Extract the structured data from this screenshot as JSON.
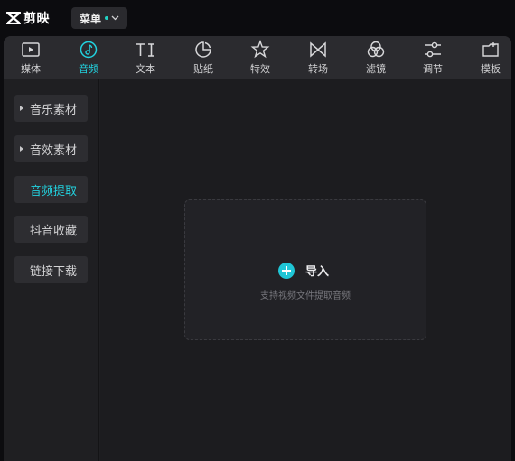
{
  "app": {
    "name": "剪映",
    "menu_label": "菜单"
  },
  "toolbar": {
    "active": "音频",
    "items": [
      {
        "label": "媒体",
        "icon": "media-play-icon"
      },
      {
        "label": "音频",
        "icon": "music-note-icon"
      },
      {
        "label": "文本",
        "icon": "text-ti-icon"
      },
      {
        "label": "贴纸",
        "icon": "sticker-icon"
      },
      {
        "label": "特效",
        "icon": "effects-star-icon"
      },
      {
        "label": "转场",
        "icon": "transition-bowtie-icon"
      },
      {
        "label": "滤镜",
        "icon": "filter-circles-icon"
      },
      {
        "label": "调节",
        "icon": "adjust-sliders-icon"
      },
      {
        "label": "模板",
        "icon": "template-icon"
      }
    ]
  },
  "sidebar": {
    "items": [
      {
        "label": "音乐素材",
        "expandable": true
      },
      {
        "label": "音效素材",
        "expandable": true
      },
      {
        "label": "音频提取",
        "active": true
      },
      {
        "label": "抖音收藏"
      },
      {
        "label": "链接下载"
      }
    ]
  },
  "dropzone": {
    "import_label": "导入",
    "hint": "支持视频文件提取音频"
  },
  "colors": {
    "accent": "#22d3e0",
    "background": "#0c0c0f",
    "panel": "#1f1f22",
    "toolbar": "#2b2b2f"
  }
}
